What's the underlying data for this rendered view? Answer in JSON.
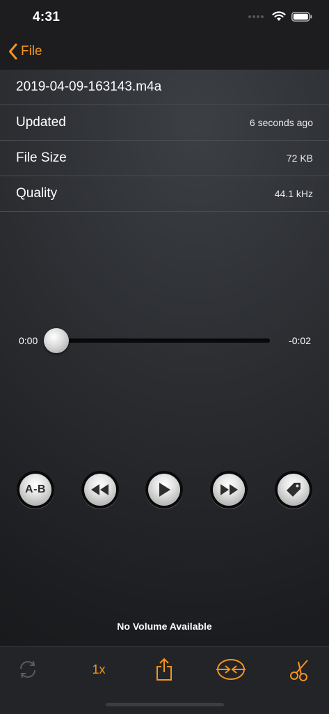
{
  "status": {
    "time": "4:31"
  },
  "nav": {
    "back_label": "File"
  },
  "file": {
    "name": "2019-04-09-163143.m4a",
    "rows": [
      {
        "label": "Updated",
        "value": "6 seconds ago"
      },
      {
        "label": "File Size",
        "value": "72 KB"
      },
      {
        "label": "Quality",
        "value": "44.1 kHz"
      }
    ]
  },
  "player": {
    "elapsed": "0:00",
    "remaining": "-0:02",
    "progress": 0,
    "ab_label": "A-B"
  },
  "volume": {
    "message": "No Volume Available"
  },
  "toolbar": {
    "speed_label": "1x"
  },
  "colors": {
    "accent": "#f7941d",
    "disabled": "#5a5b5e"
  },
  "icons": [
    "repeat-icon",
    "share-icon",
    "merge-icon",
    "scissors-icon",
    "rewind-icon",
    "play-icon",
    "fast-forward-icon",
    "tag-icon"
  ]
}
